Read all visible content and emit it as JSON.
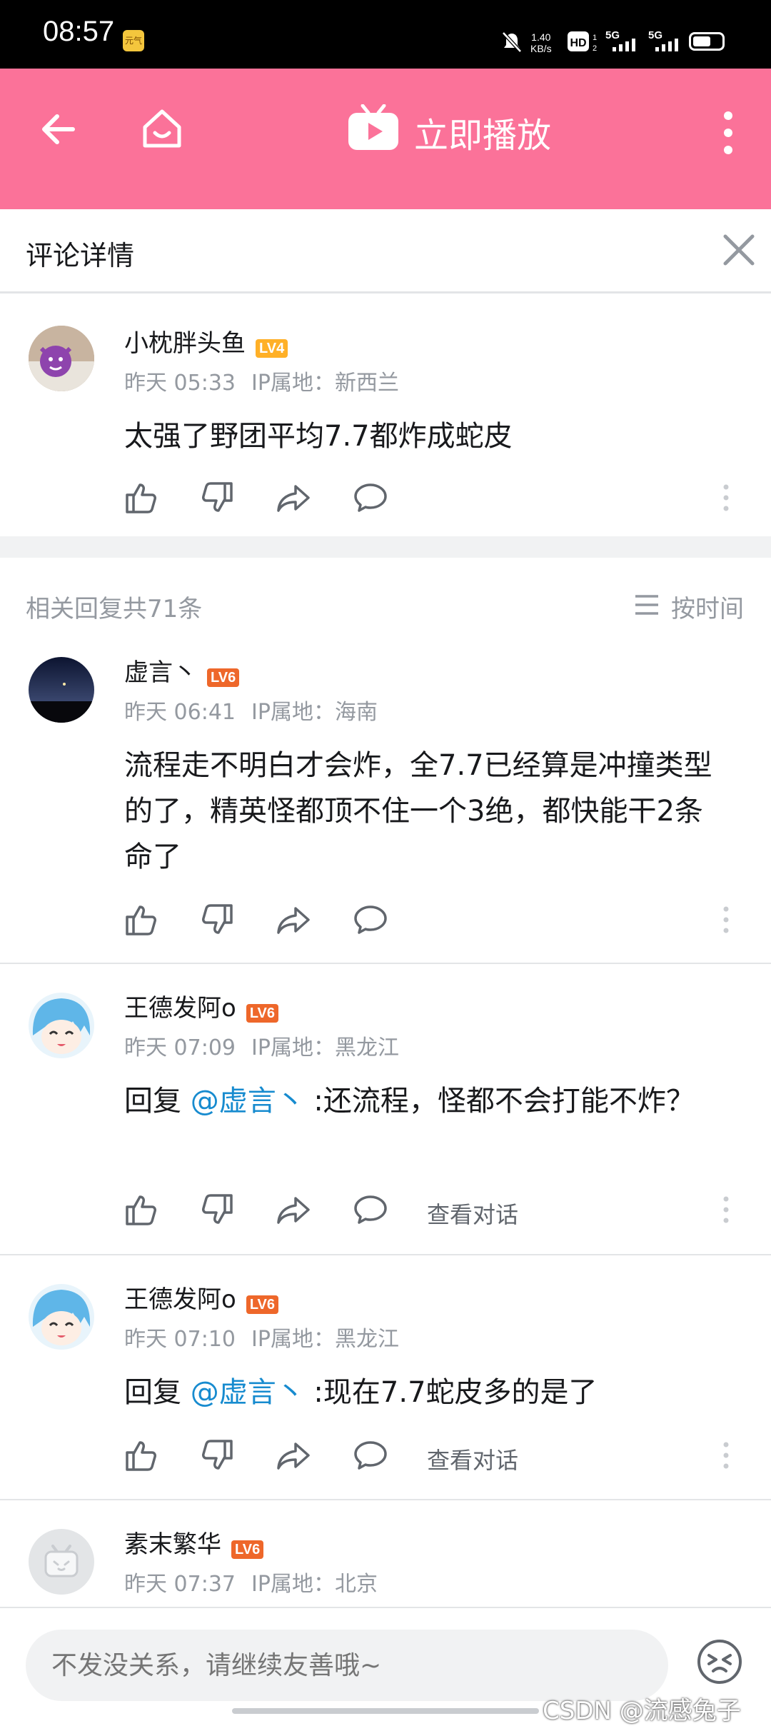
{
  "status_bar": {
    "time": "08:57",
    "app_badge": "元气",
    "net_speed": "1.40\nKB/s"
  },
  "app_bar": {
    "title": "立即播放"
  },
  "header": {
    "title": "评论详情"
  },
  "main_comment": {
    "username": "小枕胖头鱼",
    "level": "LV4",
    "time": "昨天 05:33",
    "ip": "IP属地：新西兰",
    "content": "太强了野团平均7.7都炸成蛇皮"
  },
  "replies_bar": {
    "count_label": "相关回复共71条",
    "sort_label": "按时间"
  },
  "replies": [
    {
      "username": "虚言丶",
      "level": "LV6",
      "time": "昨天 06:41",
      "ip": "IP属地：海南",
      "content": "流程走不明白才会炸，全7.7已经算是冲撞类型的了，精英怪都顶不住一个3绝，都快能干2条命了"
    },
    {
      "username": "王德发阿o",
      "level": "LV6",
      "time": "昨天 07:09",
      "ip": "IP属地：黑龙江",
      "reply_prefix": "回复 ",
      "mention": "@虚言丶",
      "content": " :还流程，怪都不会打能不炸？",
      "view_conversation": "查看对话"
    },
    {
      "username": "王德发阿o",
      "level": "LV6",
      "time": "昨天 07:10",
      "ip": "IP属地：黑龙江",
      "reply_prefix": "回复 ",
      "mention": "@虚言丶",
      "content": " :现在7.7蛇皮多的是了",
      "view_conversation": "查看对话"
    },
    {
      "username": "素末繁华",
      "level": "LV6",
      "time": "昨天 07:37",
      "ip": "IP属地：北京"
    }
  ],
  "bottom_bar": {
    "input_placeholder": "不发没关系，请继续友善哦~",
    "watermark": "CSDN @流感兔子"
  },
  "colors": {
    "brand_pink": "#fb7299",
    "lv4": "#ffb027",
    "lv6": "#ee672a",
    "mention": "#178bcf"
  },
  "icons": [
    "back-arrow-icon",
    "home-icon",
    "tv-play-icon",
    "more-vertical-icon",
    "close-icon",
    "like-icon",
    "dislike-icon",
    "share-icon",
    "comment-icon",
    "sort-icon",
    "emoji-icon"
  ]
}
